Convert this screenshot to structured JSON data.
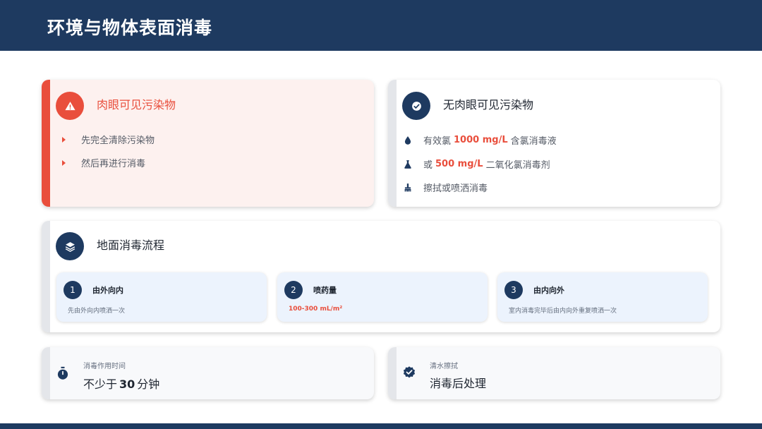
{
  "page": {
    "title": "环境与物体表面消毒"
  },
  "visible_card": {
    "title": "肉眼可见污染物",
    "icon": "warning-icon",
    "steps": [
      "先完全清除污染物",
      "然后再进行消毒"
    ],
    "accent": "#e94e3c"
  },
  "invisible_card": {
    "title": "无肉眼可见污染物",
    "icon": "check-circle-icon",
    "items": [
      {
        "icon": "droplet-icon",
        "prefix": "有效氯",
        "highlight": "1000 mg/L",
        "suffix": "含氯消毒液"
      },
      {
        "icon": "flask-icon",
        "prefix": "或",
        "highlight": "500 mg/L",
        "suffix": "二氧化氯消毒剂"
      },
      {
        "icon": "brush-icon",
        "prefix": "擦拭或喷洒消毒",
        "highlight": "",
        "suffix": ""
      }
    ]
  },
  "floor_card": {
    "title": "地面消毒流程",
    "icon": "layers-icon",
    "steps": [
      {
        "number": "1",
        "title": "由外向内",
        "desc": "先由外向内喷洒一次"
      },
      {
        "number": "2",
        "title": "喷药量",
        "desc": "100-300 mL/m²"
      },
      {
        "number": "3",
        "title": "由内向外",
        "desc": "室内消毒完毕后由内向外重复喷洒一次"
      }
    ]
  },
  "time_card": {
    "label": "消毒作用时间",
    "value_prefix": "不少于",
    "value_number": "30",
    "value_suffix": "分钟",
    "icon": "stopwatch-icon"
  },
  "rinse_card": {
    "label": "清水擦拭",
    "value": "消毒后处理",
    "icon": "badge-check-icon"
  },
  "colors": {
    "navy": "#1e3a60",
    "red": "#e94e3c",
    "step_bg": "#ecf3fd"
  }
}
